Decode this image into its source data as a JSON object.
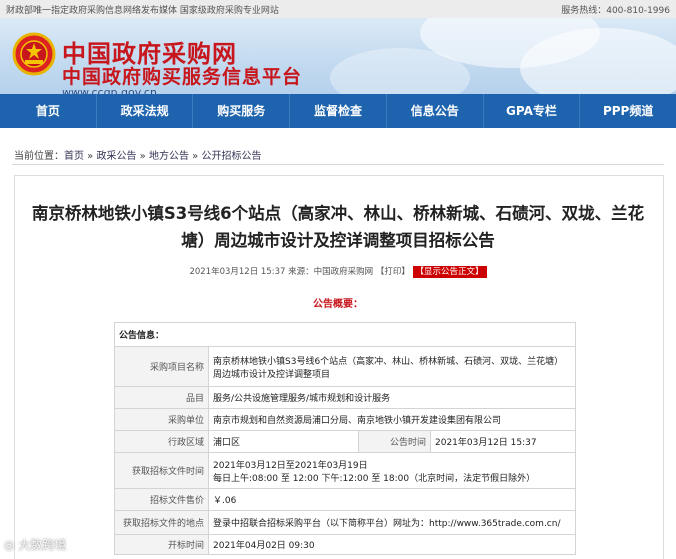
{
  "topbar": {
    "left_text": "财政部唯一指定政府采购信息网络发布媒体 国家级政府采购专业网站",
    "right_text": "服务热线：400-810-1996"
  },
  "header": {
    "title_main": "中国政府采购网",
    "title_sub": "中国政府购买服务信息平台",
    "url": "www.ccgp.gov.cn"
  },
  "nav": {
    "items": [
      "首页",
      "政采法规",
      "购买服务",
      "监督检查",
      "信息公告",
      "GPA专栏",
      "PPP频道"
    ]
  },
  "breadcrumb": {
    "prefix": "当前位置：",
    "items": [
      "首页",
      "政采公告",
      "地方公告",
      "公开招标公告"
    ],
    "sep": " » "
  },
  "article": {
    "title": "南京桥林地铁小镇S3号线6个站点（高家冲、林山、桥林新城、石碛河、双垅、兰花塘）周边城市设计及控详调整项目招标公告",
    "meta_date": "2021年03月12日 15:37",
    "meta_source": "来源：中国政府采购网",
    "print_label": "【打印】",
    "correction_label": "【显示公告正文】",
    "summary_heading": "公告概要："
  },
  "info_table": {
    "section_label": "公告信息：",
    "rows": [
      {
        "label": "采购项目名称",
        "value": "南京桥林地铁小镇S3号线6个站点（高家冲、林山、桥林新城、石碛河、双垅、兰花塘）周边城市设计及控详调整项目"
      },
      {
        "label": "品目",
        "value": "服务/公共设施管理服务/城市规划和设计服务"
      },
      {
        "label": "采购单位",
        "value": "南京市规划和自然资源局浦口分局、南京地铁小镇开发建设集团有限公司"
      },
      {
        "label": "行政区域",
        "value": "浦口区",
        "label2": "公告时间",
        "value2": "2021年03月12日 15:37"
      },
      {
        "label": "获取招标文件时间",
        "value": "2021年03月12日至2021年03月19日",
        "value_line2": "每日上午:08:00 至 12:00 下午:12:00 至 18:00（北京时间，法定节假日除外）"
      },
      {
        "label": "招标文件售价",
        "value": "￥.06"
      },
      {
        "label": "获取招标文件的地点",
        "value": "登录中招联合招标采购平台（以下简称平台）网址为：http://www.365trade.com.cn/"
      },
      {
        "label": "开标时间",
        "value": "2021年04月02日 09:30"
      }
    ]
  },
  "watermark": {
    "text": "大数跨境"
  },
  "colors": {
    "nav_bg": "#1d63ad",
    "brand_red": "#c8161d"
  }
}
